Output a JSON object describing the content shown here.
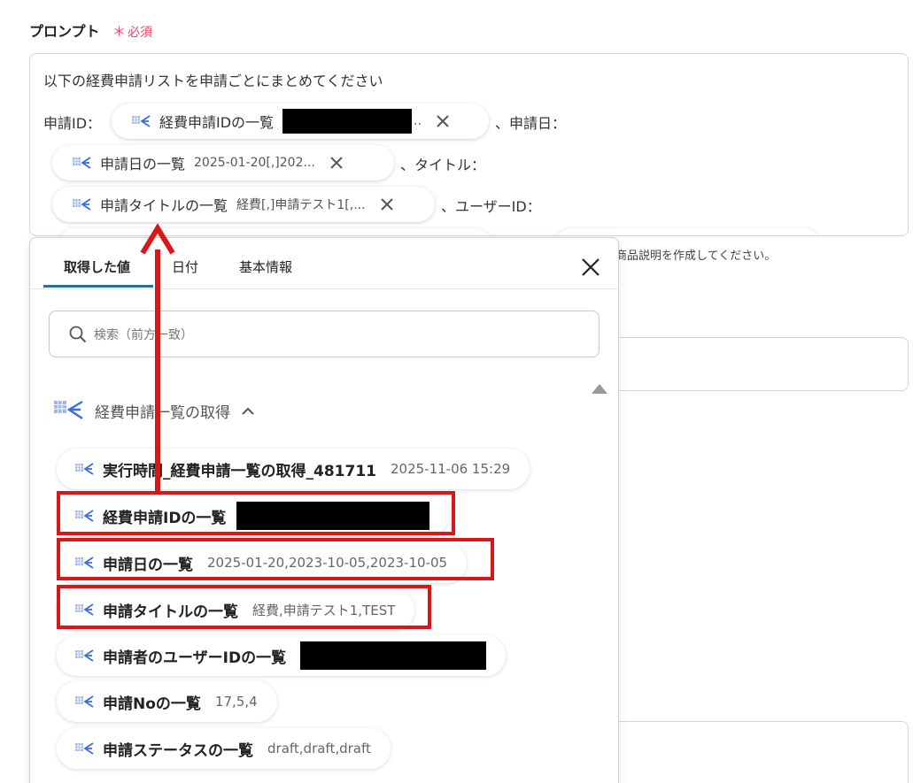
{
  "field": {
    "label": "プロンプト",
    "required_mark": "＊",
    "required_text": "必須"
  },
  "prompt": {
    "line1": "以下の経費申請リストを申請ごとにまとめてください",
    "row2_prefix": "申請ID：",
    "row2_suffix": "、申請日：",
    "row3_suffix": "、タイトル：",
    "row4_suffix": "、ユーザーID：",
    "pills": [
      {
        "label": "経費申請IDの一覧",
        "value": ""
      },
      {
        "label": "申請日の一覧",
        "value": "2025-01-20[,]202..."
      },
      {
        "label": "申請タイトルの一覧",
        "value": "経費[,]申請テスト1[,..."
      }
    ]
  },
  "hint": "商品説明を作成してください。",
  "panel": {
    "tabs": [
      "取得した値",
      "日付",
      "基本情報"
    ],
    "search_placeholder": "検索（前方一致）",
    "section_title": "経費申請一覧の取得",
    "items": [
      {
        "label": "実行時間_経費申請一覧の取得_481711",
        "value": "2025-11-06 15:29"
      },
      {
        "label": "経費申請IDの一覧",
        "value": ""
      },
      {
        "label": "申請日の一覧",
        "value": "2025-01-20,2023-10-05,2023-10-05"
      },
      {
        "label": "申請タイトルの一覧",
        "value": "経費,申請テスト1,TEST"
      },
      {
        "label": "申請者のユーザーIDの一覧",
        "value": ""
      },
      {
        "label": "申請Noの一覧",
        "value": "17,5,4"
      },
      {
        "label": "申請ステータスの一覧",
        "value": "draft,draft,draft"
      }
    ]
  },
  "colors": {
    "accent": "#2a6f8f",
    "required": "#e9476b",
    "highlight": "#d81818",
    "icon": "#3b6fd8"
  },
  "icons": [
    "spreadsheet-plane-icon",
    "close-icon",
    "search-icon",
    "chevron-up-icon"
  ]
}
